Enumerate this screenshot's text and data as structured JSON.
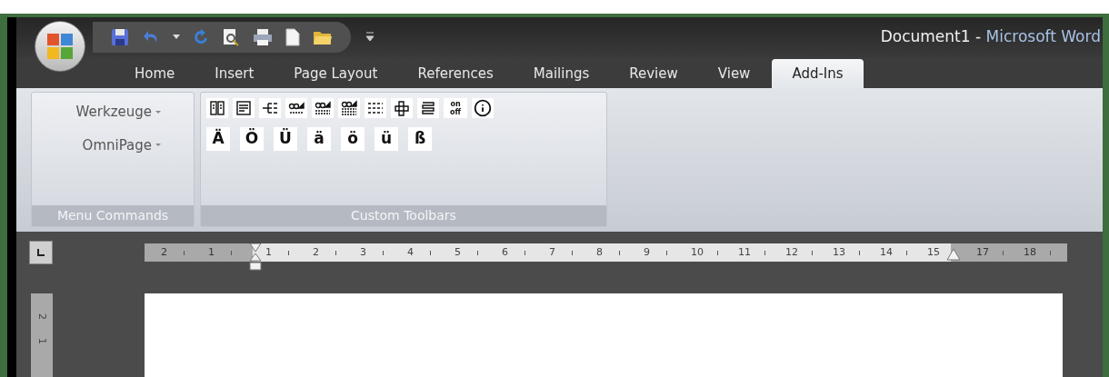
{
  "window": {
    "document": "Document1",
    "separator": "-",
    "app": "Microsoft Word"
  },
  "tabs": [
    {
      "label": "Home",
      "selected": false
    },
    {
      "label": "Insert",
      "selected": false
    },
    {
      "label": "Page Layout",
      "selected": false
    },
    {
      "label": "References",
      "selected": false
    },
    {
      "label": "Mailings",
      "selected": false
    },
    {
      "label": "Review",
      "selected": false
    },
    {
      "label": "View",
      "selected": false
    },
    {
      "label": "Add-Ins",
      "selected": true
    }
  ],
  "groups": [
    {
      "kind": "menus",
      "label": "Menu Commands",
      "menus": [
        "Werkzeuge",
        "OmniPage"
      ]
    },
    {
      "kind": "toolbars",
      "label": "Custom Toolbars",
      "toggle_labels": [
        "on",
        "off"
      ],
      "characters": [
        "Ä",
        "Ö",
        "Ü",
        "ä",
        "ö",
        "ü",
        "ß"
      ]
    }
  ],
  "horizontal_ruler": {
    "left_margin_labels": [
      "2",
      "1"
    ],
    "body_labels": [
      "1",
      "2",
      "3",
      "4",
      "5",
      "6",
      "7",
      "8",
      "9",
      "10",
      "11",
      "12",
      "13",
      "14",
      "15"
    ],
    "right_margin_labels": [
      "17",
      "18"
    ]
  },
  "vertical_ruler": {
    "labels": [
      "2",
      "1"
    ]
  }
}
